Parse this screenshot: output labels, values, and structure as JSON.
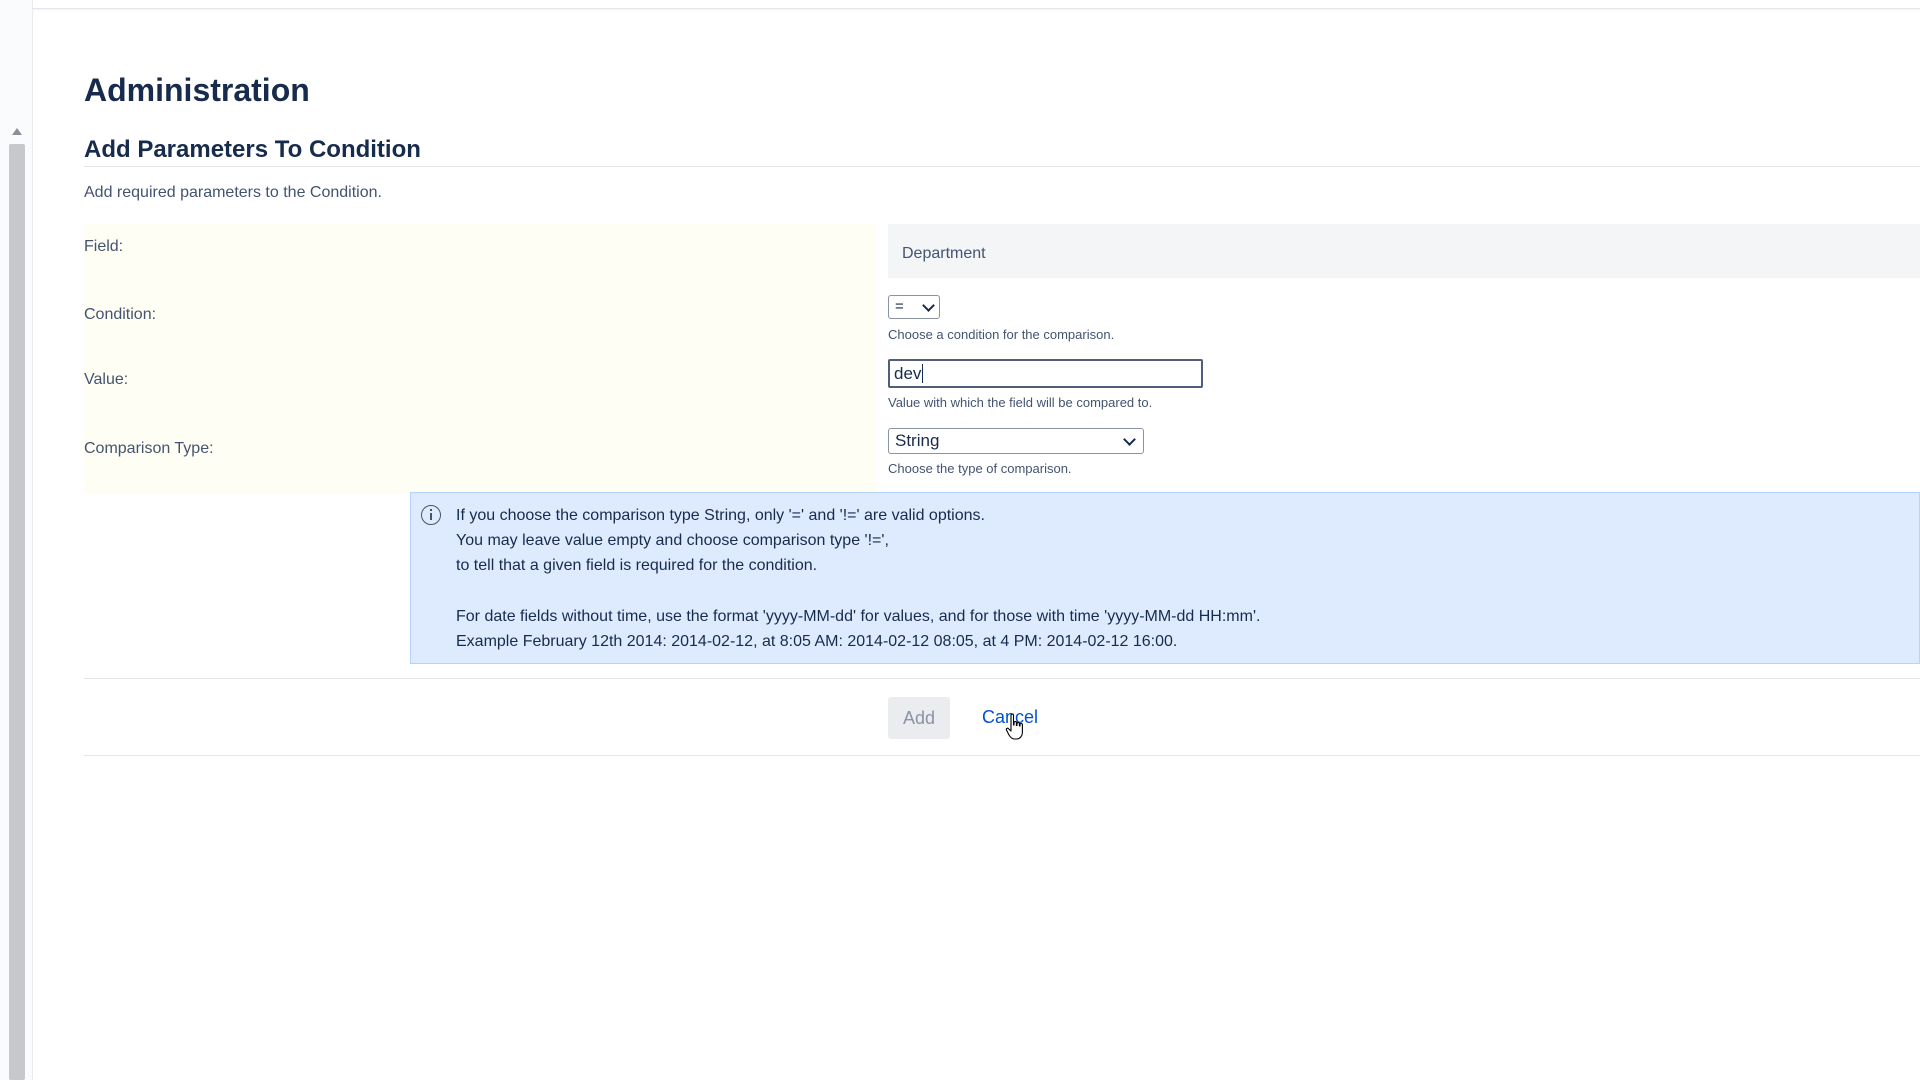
{
  "page": {
    "title": "Administration"
  },
  "section": {
    "title": "Add Parameters To Condition",
    "description": "Add required parameters to the Condition."
  },
  "form": {
    "field": {
      "label": "Field:",
      "value": "Department"
    },
    "condition": {
      "label": "Condition:",
      "selected": "=",
      "help": "Choose a condition for the comparison."
    },
    "value": {
      "label": "Value:",
      "input_value": "dev",
      "help": "Value with which the field will be compared to."
    },
    "comparison_type": {
      "label": "Comparison Type:",
      "selected": "String",
      "help": "Choose the type of comparison."
    }
  },
  "info": {
    "icon": "info-icon",
    "lines": [
      "If you choose the comparison type String, only '=' and '!=' are valid options.",
      "You may leave value empty and choose comparison type '!=',",
      "to tell that a given field is required for the condition.",
      "For date fields without time, use the format 'yyyy-MM-dd' for values, and for those with time 'yyyy-MM-dd HH:mm'.",
      "Example February 12th 2014: 2014-02-12, at 8:05 AM: 2014-02-12 08:05, at 4 PM: 2014-02-12 16:00."
    ]
  },
  "actions": {
    "add_label": "Add",
    "cancel_label": "Cancel"
  },
  "colors": {
    "label_panel": "#fefef4",
    "info_background": "#deebff",
    "link": "#0052cc"
  }
}
